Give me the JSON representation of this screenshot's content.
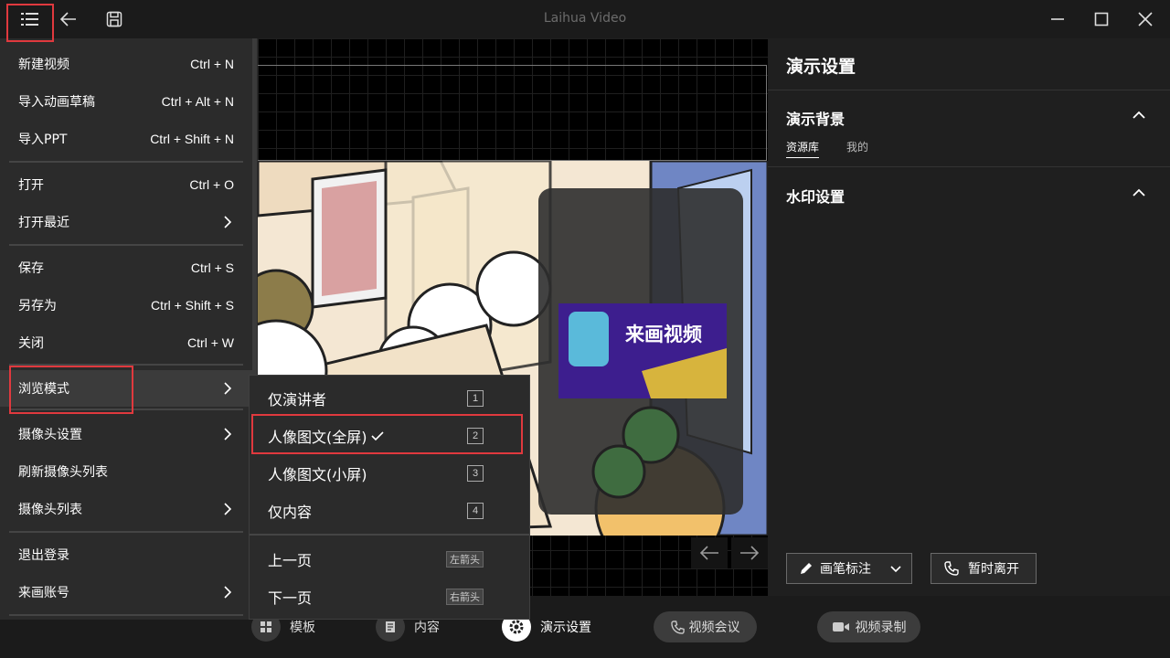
{
  "window": {
    "title": "Laihua Video"
  },
  "canvas": {
    "artwork_banner": {
      "headline": "来画视频"
    }
  },
  "right_panel": {
    "title": "演示设置",
    "background_section": {
      "label": "演示背景",
      "tabs": [
        "资源库",
        "我的"
      ],
      "active_tab": "资源库"
    },
    "watermark_section": {
      "label": "水印设置"
    },
    "pen_button": "画笔标注",
    "away_button": "暂时离开"
  },
  "bottom_bar": {
    "template": "模板",
    "content": "内容",
    "present_settings": "演示设置",
    "video_meeting": "视频会议",
    "video_record": "视频录制"
  },
  "menu": {
    "new_video": {
      "label": "新建视频",
      "shortcut": "Ctrl + N"
    },
    "import_draft": {
      "label": "导入动画草稿",
      "shortcut": "Ctrl + Alt + N"
    },
    "import_ppt": {
      "label": "导入PPT",
      "shortcut": "Ctrl + Shift + N"
    },
    "open": {
      "label": "打开",
      "shortcut": "Ctrl + O"
    },
    "open_recent": {
      "label": "打开最近"
    },
    "save": {
      "label": "保存",
      "shortcut": "Ctrl + S"
    },
    "save_as": {
      "label": "另存为",
      "shortcut": "Ctrl + Shift + S"
    },
    "close": {
      "label": "关闭",
      "shortcut": "Ctrl + W"
    },
    "browse_mode": {
      "label": "浏览模式"
    },
    "camera_settings": {
      "label": "摄像头设置"
    },
    "refresh_cameras": {
      "label": "刷新摄像头列表"
    },
    "camera_list": {
      "label": "摄像头列表"
    },
    "logout": {
      "label": "退出登录"
    },
    "account": {
      "label": "来画账号"
    }
  },
  "submenu": {
    "presenter_only": {
      "label": "仅演讲者",
      "key": "1"
    },
    "portrait_full": {
      "label": "人像图文(全屏)",
      "key": "2",
      "checked": true
    },
    "portrait_small": {
      "label": "人像图文(小屏)",
      "key": "3"
    },
    "content_only": {
      "label": "仅内容",
      "key": "4"
    },
    "prev_page": {
      "label": "上一页",
      "key": "左箭头"
    },
    "next_page": {
      "label": "下一页",
      "key": "右箭头"
    }
  },
  "colors": {
    "highlight": "#e0393e",
    "menu_bg": "#2b2b2b",
    "panel_bg": "#1f1f1f",
    "app_bg": "#1b1b1b"
  }
}
